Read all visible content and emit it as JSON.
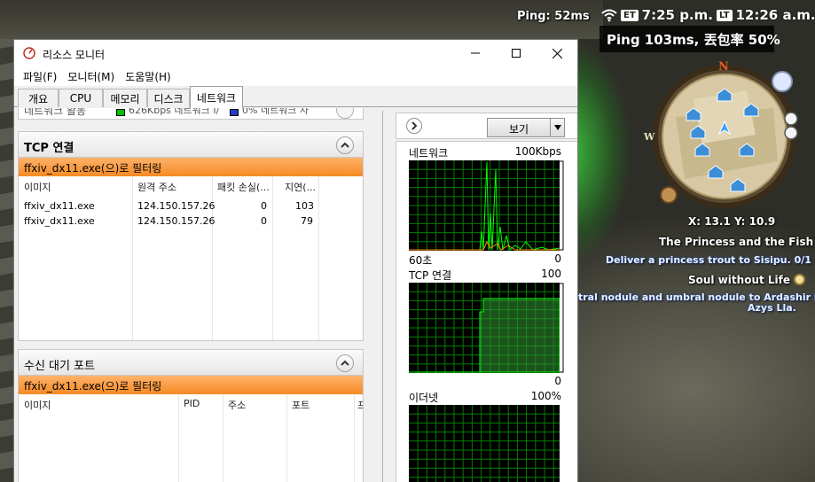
{
  "game": {
    "ping_small": "Ping: 52ms",
    "ping_box": "Ping 103ms, 丟包率 50%",
    "clock": {
      "et_badge": "ET",
      "et_time": "7:25 p.m.",
      "lt_badge": "LT",
      "lt_time": "12:26 a.m."
    },
    "compass_north": "N",
    "compass_west": "W",
    "coords": "X: 13.1 Y: 10.9",
    "quests": [
      {
        "title": "The Princess and the Fish",
        "step": "Deliver a princess trout  to Sisipu. 0/1"
      },
      {
        "title": "Soul without Life",
        "step": "tral nodule and umbral nodule to Ardashir in",
        "step2": "Azys Lla."
      }
    ]
  },
  "window": {
    "title": "리소스 모니터",
    "menu": [
      "파일(F)",
      "모니터(M)",
      "도움말(H)"
    ],
    "tabs": [
      "개요",
      "CPU",
      "메모리",
      "디스크",
      "네트워크"
    ],
    "active_tab": 4,
    "strip": {
      "label": "네트워크 활동",
      "clip1": "626Kbps 네트워크 I/",
      "clip2": "0% 네트워크 사"
    },
    "tcp": {
      "title": "TCP 연결",
      "filter": "ffxiv_dx11.exe(으)로 필터링",
      "columns": [
        "이미지",
        "원격 주소",
        "패킷 손실(...",
        "지연(..."
      ],
      "rows": [
        {
          "image": "ffxiv_dx11.exe",
          "remote": "124.150.157.26",
          "loss": "0",
          "latency": "103"
        },
        {
          "image": "ffxiv_dx11.exe",
          "remote": "124.150.157.26",
          "loss": "0",
          "latency": "79"
        }
      ]
    },
    "listen": {
      "title": "수신 대기 포트",
      "filter": "ffxiv_dx11.exe(으)로 필터링",
      "columns": [
        "이미지",
        "PID",
        "주소",
        "포트",
        "프"
      ]
    },
    "graphs": {
      "view_label": "보기",
      "network": {
        "title": "네트워크",
        "max": "100Kbps",
        "footer_left": "60초",
        "footer_right": "0"
      },
      "tcp": {
        "title": "TCP 연결",
        "max": "100",
        "footer_right": "0"
      },
      "ethernet": {
        "title": "이더넷",
        "max": "100%"
      }
    },
    "colors": {
      "filter_orange": "#f58a23",
      "graph_green": "#00ff00",
      "graph_bg": "#000000",
      "grid": "#008000",
      "legend_green": "#00c000",
      "legend_blue": "#1e3cc8"
    }
  }
}
